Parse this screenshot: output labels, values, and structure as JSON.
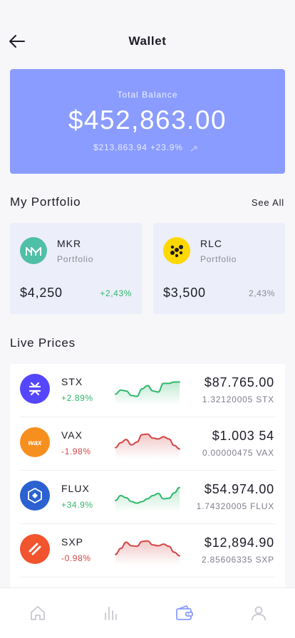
{
  "header": {
    "title": "Wallet"
  },
  "balance": {
    "label": "Total Balance",
    "amount": "$452,863.00",
    "change": "$213,863.94 +23.9%",
    "trend_icon": "trend-up-arrow-icon"
  },
  "portfolio": {
    "title": "My Portfolio",
    "see_all": "See All",
    "items": [
      {
        "symbol": "MKR",
        "sub": "Portfolio",
        "value": "$4,250",
        "change": "+2,43%",
        "trend": "up",
        "icon": "maker-logo-icon",
        "color": "#4fbfa8"
      },
      {
        "symbol": "RLC",
        "sub": "Portfolio",
        "value": "$3,500",
        "change": "2,43%",
        "trend": "neutral",
        "icon": "iexec-logo-icon",
        "color": "#ffd800"
      }
    ]
  },
  "live": {
    "title": "Live Prices",
    "items": [
      {
        "symbol": "STX",
        "change": "+2.89%",
        "trend": "up",
        "price": "$87.765.00",
        "amount": "1.32120005 STX",
        "icon": "stacks-logo-icon",
        "color": "#5546ff",
        "spark": [
          0.3,
          0.45,
          0.42,
          0.25,
          0.22,
          0.5,
          0.62,
          0.42,
          0.38,
          0.7,
          0.7,
          0.75,
          0.75
        ]
      },
      {
        "symbol": "VAX",
        "change": "-1.98%",
        "trend": "down",
        "price": "$1.003 54",
        "amount": "0.00000475 VAX",
        "icon": "wax-logo-icon",
        "color": "#f78f1e",
        "spark": [
          0.3,
          0.48,
          0.6,
          0.4,
          0.5,
          0.78,
          0.8,
          0.65,
          0.62,
          0.7,
          0.62,
          0.38,
          0.25
        ]
      },
      {
        "symbol": "FLUX",
        "change": "+34.9%",
        "trend": "up",
        "price": "$54.974.00",
        "amount": "1.74320005 FLUX",
        "icon": "flux-logo-icon",
        "color": "#2b61d1",
        "spark": [
          0.32,
          0.5,
          0.42,
          0.28,
          0.22,
          0.28,
          0.38,
          0.5,
          0.58,
          0.38,
          0.4,
          0.6,
          0.8
        ]
      },
      {
        "symbol": "SXP",
        "change": "-0.98%",
        "trend": "down",
        "price": "$12,894.90",
        "amount": "2.85606335 SXP",
        "icon": "swipe-logo-icon",
        "color": "#f2542d",
        "spark": [
          0.3,
          0.52,
          0.75,
          0.62,
          0.6,
          0.78,
          0.8,
          0.65,
          0.62,
          0.68,
          0.6,
          0.38,
          0.25
        ]
      }
    ]
  },
  "nav": [
    {
      "name": "home-icon",
      "active": false
    },
    {
      "name": "chart-icon",
      "active": false
    },
    {
      "name": "wallet-icon",
      "active": true
    },
    {
      "name": "profile-icon",
      "active": false
    }
  ],
  "colors": {
    "accent": "#8a9cff",
    "up": "#2fb86b",
    "down": "#d44545",
    "nav_active": "#8a9cff",
    "nav_inactive": "#c8c8d2"
  }
}
